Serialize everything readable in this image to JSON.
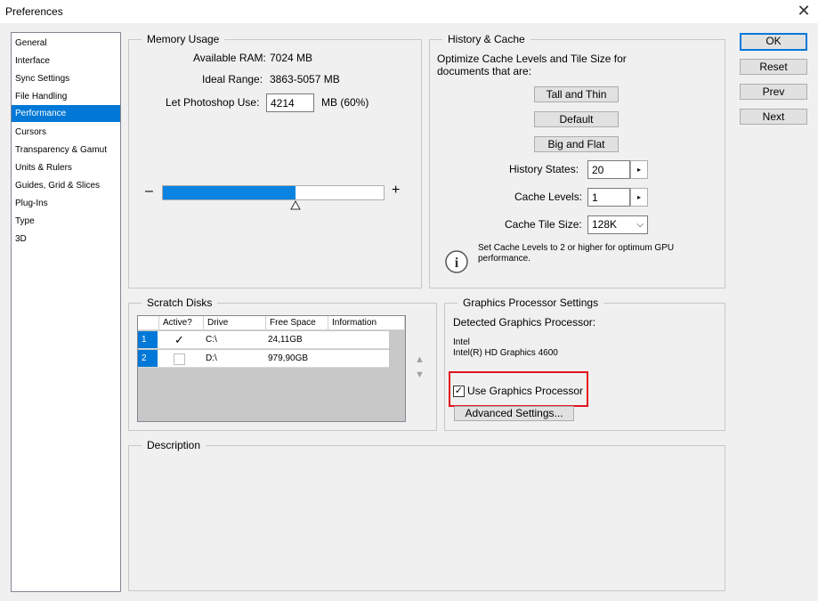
{
  "window": {
    "title": "Preferences",
    "close_glyph": "✕"
  },
  "sidebar": {
    "items": [
      {
        "label": "General"
      },
      {
        "label": "Interface"
      },
      {
        "label": "Sync Settings"
      },
      {
        "label": "File Handling"
      },
      {
        "label": "Performance",
        "selected": true
      },
      {
        "label": "Cursors"
      },
      {
        "label": "Transparency & Gamut"
      },
      {
        "label": "Units & Rulers"
      },
      {
        "label": "Guides, Grid & Slices"
      },
      {
        "label": "Plug-Ins"
      },
      {
        "label": "Type"
      },
      {
        "label": "3D"
      }
    ]
  },
  "memory": {
    "title": "Memory Usage",
    "available_label": "Available RAM:",
    "available_value": "7024 MB",
    "ideal_label": "Ideal Range:",
    "ideal_value": "3863-5057 MB",
    "let_label": "Let Photoshop Use:",
    "let_value": "4214",
    "let_unit": "MB (60%)",
    "minus": "–",
    "plus": "+",
    "slider_percent": 60
  },
  "history": {
    "title": "History & Cache",
    "desc": "Optimize Cache Levels and Tile Size for documents that are:",
    "preset1": "Tall and Thin",
    "preset2": "Default",
    "preset3": "Big and Flat",
    "states_label": "History States:",
    "states_value": "20",
    "levels_label": "Cache Levels:",
    "levels_value": "1",
    "tile_label": "Cache Tile Size:",
    "tile_value": "128K",
    "note": "Set Cache Levels to 2 or higher for optimum GPU performance.",
    "info_glyph": "i",
    "arrow_glyph": "▸",
    "dropdown_glyph": "⌵"
  },
  "scratch": {
    "title": "Scratch Disks",
    "headers": [
      "Active?",
      "Drive",
      "Free Space",
      "Information"
    ],
    "rows": [
      {
        "num": "1",
        "active": true,
        "check": "✓",
        "drive": "C:\\",
        "free": "24,11GB",
        "info": ""
      },
      {
        "num": "2",
        "active": false,
        "check": "",
        "drive": "D:\\",
        "free": "979,90GB",
        "info": ""
      }
    ],
    "move_up": "▲",
    "move_down": "▼",
    "scroll_up": "⌃",
    "scroll_down": "⌄"
  },
  "gpu": {
    "title": "Graphics Processor Settings",
    "detected_label": "Detected Graphics Processor:",
    "vendor": "Intel",
    "model": "Intel(R) HD Graphics 4600",
    "use_label": "Use Graphics Processor",
    "use_checked": true,
    "check": "✓",
    "advanced": "Advanced Settings...",
    "highlight_color": "#e0141e"
  },
  "description": {
    "title": "Description"
  },
  "buttons": {
    "ok": "OK",
    "reset": "Reset",
    "prev": "Prev",
    "next": "Next"
  },
  "colors": {
    "accent": "#0078d7",
    "slider_fill": "#0a84e0"
  }
}
